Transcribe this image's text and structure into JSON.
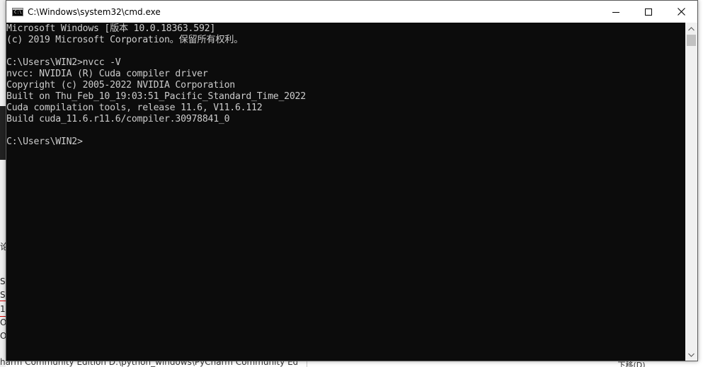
{
  "window": {
    "title": "C:\\Windows\\system32\\cmd.exe",
    "icon": "cmd-icon",
    "icon_glyph": "C:\\"
  },
  "controls": {
    "minimize": "minimize-icon",
    "maximize": "maximize-icon",
    "close": "close-icon"
  },
  "console": {
    "lines": [
      "Microsoft Windows [版本 10.0.18363.592]",
      "(c) 2019 Microsoft Corporation。保留所有权利。",
      "",
      "C:\\Users\\WIN2>nvcc -V",
      "nvcc: NVIDIA (R) Cuda compiler driver",
      "Copyright (c) 2005-2022 NVIDIA Corporation",
      "Built on Thu_Feb_10_19:03:51_Pacific_Standard_Time_2022",
      "Cuda compilation tools, release 11.6, V11.6.112",
      "Build cuda_11.6.r11.6/compiler.30978841_0",
      "",
      "C:\\Users\\WIN2>"
    ],
    "text_color": "#cccccc",
    "background": "#0c0c0c"
  },
  "background_app": {
    "fragments": [
      "论",
      "S",
      "S",
      "1",
      "O",
      "O"
    ],
    "bottom_text": "harm Community Edition  D:\\python_windows\\PyCharm Community Editi",
    "bottom_button": "下移(D)"
  }
}
